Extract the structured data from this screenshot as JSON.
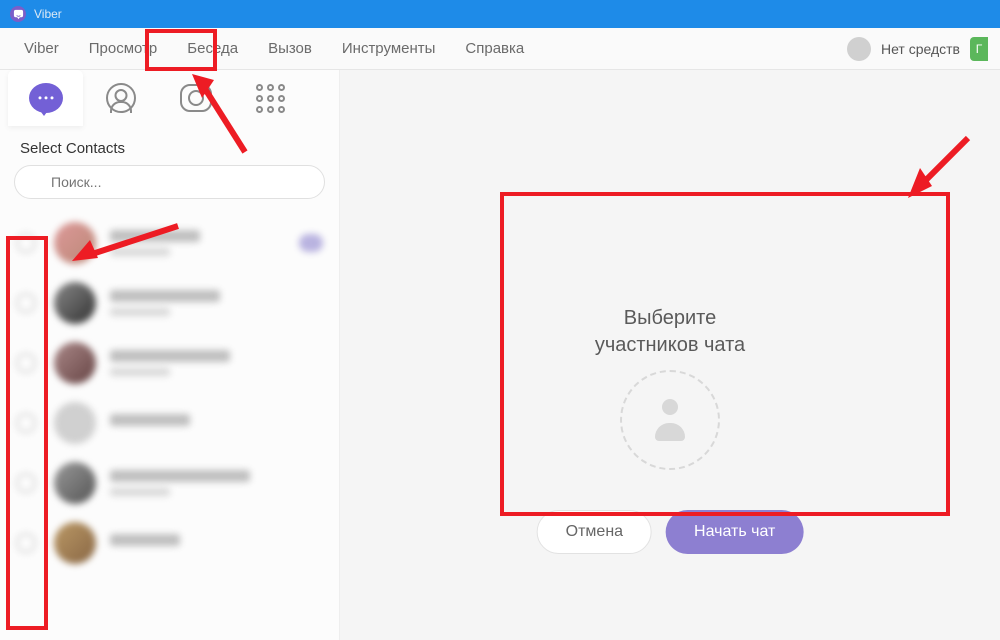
{
  "titlebar": {
    "app_name": "Viber"
  },
  "menu": {
    "items": [
      "Viber",
      "Просмотр",
      "Беседа",
      "Вызов",
      "Инструменты",
      "Справка"
    ]
  },
  "header_right": {
    "no_funds": "Нет средств",
    "badge_letter": "Г"
  },
  "sidebar": {
    "section_title": "Select Contacts",
    "search_placeholder": "Поиск..."
  },
  "main": {
    "prompt_line1": "Выберите",
    "prompt_line2": "участников чата",
    "cancel_label": "Отмена",
    "start_label": "Начать чат"
  },
  "annotations": {
    "highlight_menu": "Беседа",
    "highlight_area": "contact-radios",
    "highlight_panel": "chat-create-panel"
  }
}
